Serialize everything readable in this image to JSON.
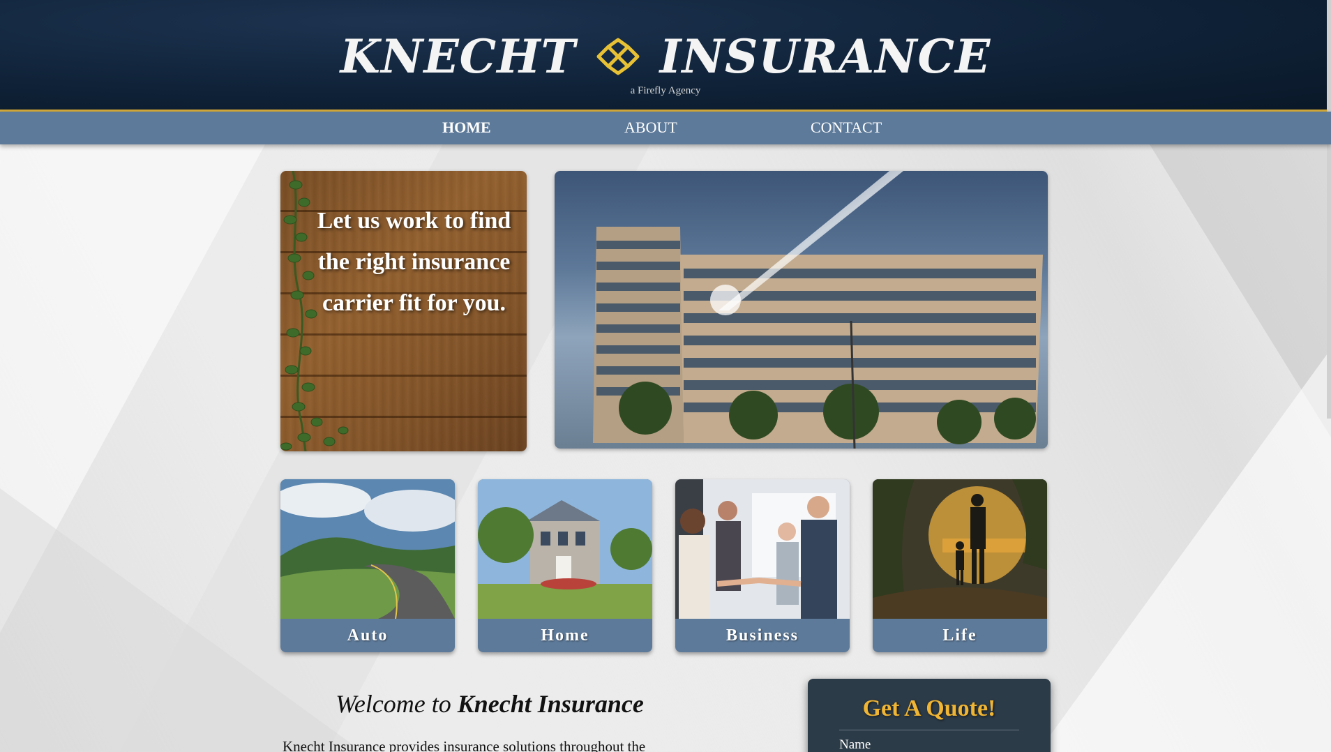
{
  "header": {
    "brand_left": "KNECHT",
    "brand_right": "INSURANCE",
    "tagline": "a Firefly Agency",
    "logo_mark_icon": "firefly-knot-icon",
    "accent_color": "#d4a93a",
    "background_color": "#0f2238"
  },
  "nav": {
    "items": [
      {
        "label": "HOME",
        "active": true
      },
      {
        "label": "ABOUT",
        "active": false
      },
      {
        "label": "CONTACT",
        "active": false
      }
    ],
    "background_color": "#5d7a9a"
  },
  "hero": {
    "quote": "Let us work to find the right insurance carrier fit for you.",
    "image_left": "wood-planks-with-ivy",
    "image_right": "office-building-photo"
  },
  "tiles": [
    {
      "label": "Auto",
      "image": "mountain-road-photo"
    },
    {
      "label": "Home",
      "image": "suburban-house-photo"
    },
    {
      "label": "Business",
      "image": "business-handshake-photo"
    },
    {
      "label": "Life",
      "image": "family-sunset-walk-photo"
    }
  ],
  "welcome": {
    "prefix": "Welcome to",
    "brand": "Knecht Insurance",
    "body": "Knecht Insurance provides insurance solutions throughout the"
  },
  "quote_form": {
    "title": "Get A Quote!",
    "name_label": "Name",
    "title_color": "#f0b533",
    "panel_color": "#2c3b48"
  }
}
